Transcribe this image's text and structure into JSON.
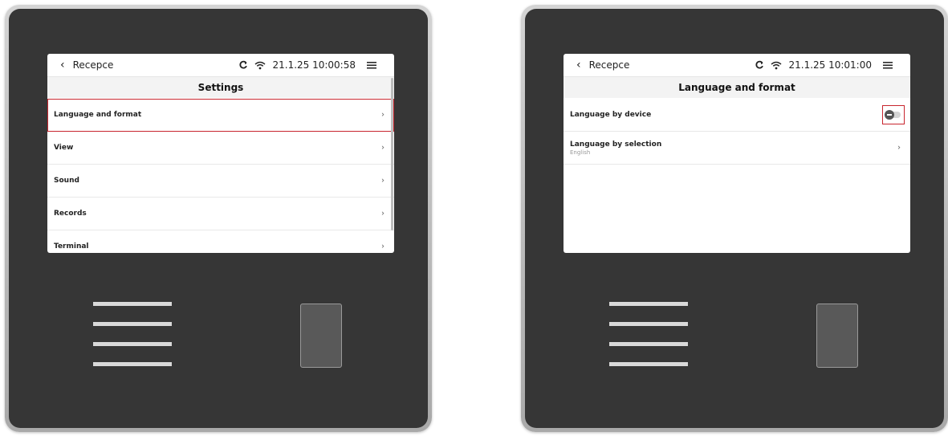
{
  "left_device": {
    "status": {
      "back_label": "Recepce",
      "datetime": "21.1.25 10:00:58"
    },
    "title": "Settings",
    "items": [
      {
        "label": "Language and format"
      },
      {
        "label": "View"
      },
      {
        "label": "Sound"
      },
      {
        "label": "Records"
      },
      {
        "label": "Terminal"
      }
    ],
    "highlighted_item": "Language and format"
  },
  "right_device": {
    "status": {
      "back_label": "Recepce",
      "datetime": "21.1.25 10:01:00"
    },
    "title": "Language and format",
    "items": [
      {
        "label": "Language by device",
        "toggle": "off"
      },
      {
        "label": "Language by selection",
        "value": "English"
      }
    ]
  },
  "icons": {
    "back": "chevron-left-icon",
    "refresh": "refresh-icon",
    "wifi": "wifi-icon",
    "menu": "hamburger-menu-icon",
    "row_chevron": "chevron-right-icon"
  },
  "colors": {
    "device_face": "#363636",
    "highlight": "#c8252e",
    "title_bar": "#f3f3f3"
  }
}
